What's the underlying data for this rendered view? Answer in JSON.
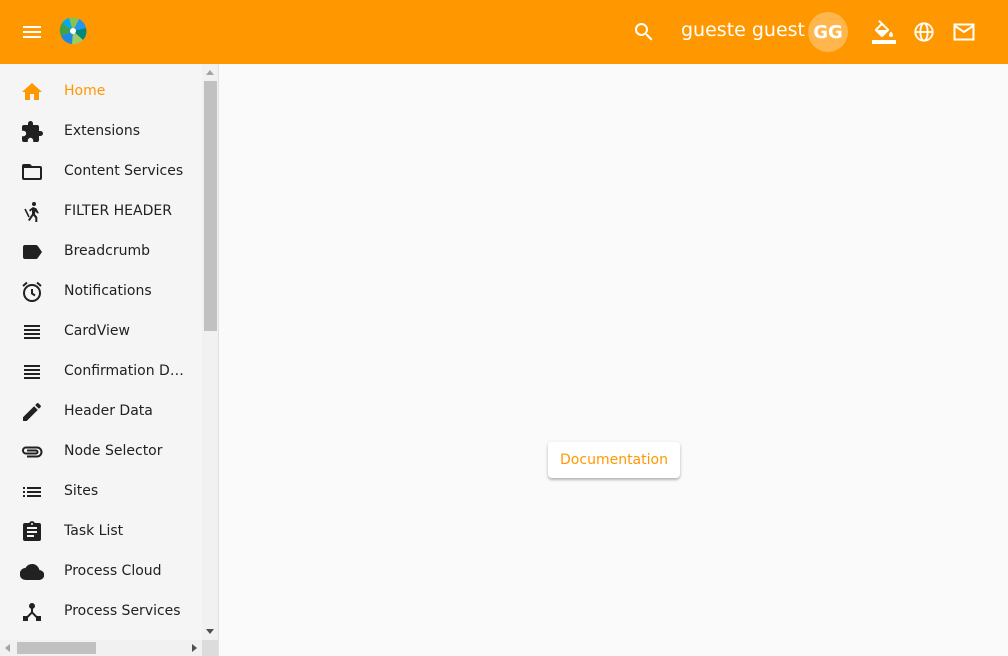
{
  "header": {
    "user_name": "gueste guest",
    "avatar_initials": "GG",
    "brand_color": "#ff9800",
    "icons": [
      "menu-icon",
      "logo",
      "search-icon",
      "format-color-fill-icon",
      "language-icon",
      "mail-icon"
    ]
  },
  "sidebar": {
    "items": [
      {
        "label": "Home",
        "icon": "home-icon",
        "active": true
      },
      {
        "label": "Extensions",
        "icon": "extension-icon"
      },
      {
        "label": "Content Services",
        "icon": "folder-icon"
      },
      {
        "label": "FILTER HEADER",
        "icon": "filter-header-icon"
      },
      {
        "label": "Breadcrumb",
        "icon": "label-icon"
      },
      {
        "label": "Notifications",
        "icon": "alarm-icon"
      },
      {
        "label": "CardView",
        "icon": "view-headline-icon"
      },
      {
        "label": "Confirmation Dialog",
        "icon": "view-headline-icon"
      },
      {
        "label": "Header Data",
        "icon": "edit-icon"
      },
      {
        "label": "Node Selector",
        "icon": "attachment-icon"
      },
      {
        "label": "Sites",
        "icon": "list-icon"
      },
      {
        "label": "Task List",
        "icon": "assignment-icon"
      },
      {
        "label": "Process Cloud",
        "icon": "cloud-icon"
      },
      {
        "label": "Process Services",
        "icon": "device-hub-icon"
      }
    ]
  },
  "main": {
    "documentation_label": "Documentation"
  }
}
